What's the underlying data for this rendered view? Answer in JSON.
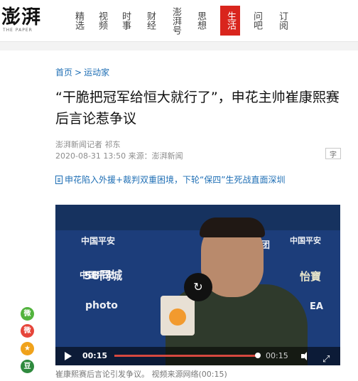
{
  "header": {
    "logo_text": "澎湃",
    "logo_sub": "THE PAPER",
    "nav": [
      "精选",
      "视频",
      "时事",
      "财经",
      "澎湃号",
      "思想",
      "生活",
      "问吧",
      "订阅"
    ],
    "active_nav": "生活"
  },
  "breadcrumb": {
    "home": "首页",
    "separator": ">",
    "section": "运动家"
  },
  "article": {
    "title": "“干脆把冠军给恒大就行了”，申花主帅崔康熙赛后言论惹争议",
    "author": "澎湃新闻记者 祁东",
    "date_source": "2020-08-31 13:50 来源：澎湃新闻",
    "font_button": "字",
    "related_link": "申花陷入外援+裁判双重困境，下轮“保四”生死战直面深圳"
  },
  "video": {
    "current_time": "00:15",
    "duration": "00:15",
    "progress": 1.0,
    "background_text": [
      "中国平安",
      "中国平安",
      "中国平安",
      "58同城",
      "汽车集团",
      "怡寶",
      "photo",
      "EA"
    ],
    "caption": "崔康熙赛后言论引发争议。 视频来源网络(00:15)"
  },
  "share": {
    "wechat": "微",
    "weibo": "微",
    "qzone": "★",
    "douban": "豆"
  },
  "colors": {
    "accent_red": "#d9251d",
    "link_blue": "#1f6fb5",
    "wechat_green": "#52b33d",
    "weibo_red": "#e6453a",
    "qzone_yellow": "#f0a21b",
    "douban_green": "#2f8a3e"
  },
  "icons": {
    "related_link_icon": "document-icon",
    "center_button_icon": "replay-icon",
    "play_icon": "play-icon",
    "volume_icon": "volume-icon",
    "fullscreen_icon": "fullscreen-icon"
  }
}
